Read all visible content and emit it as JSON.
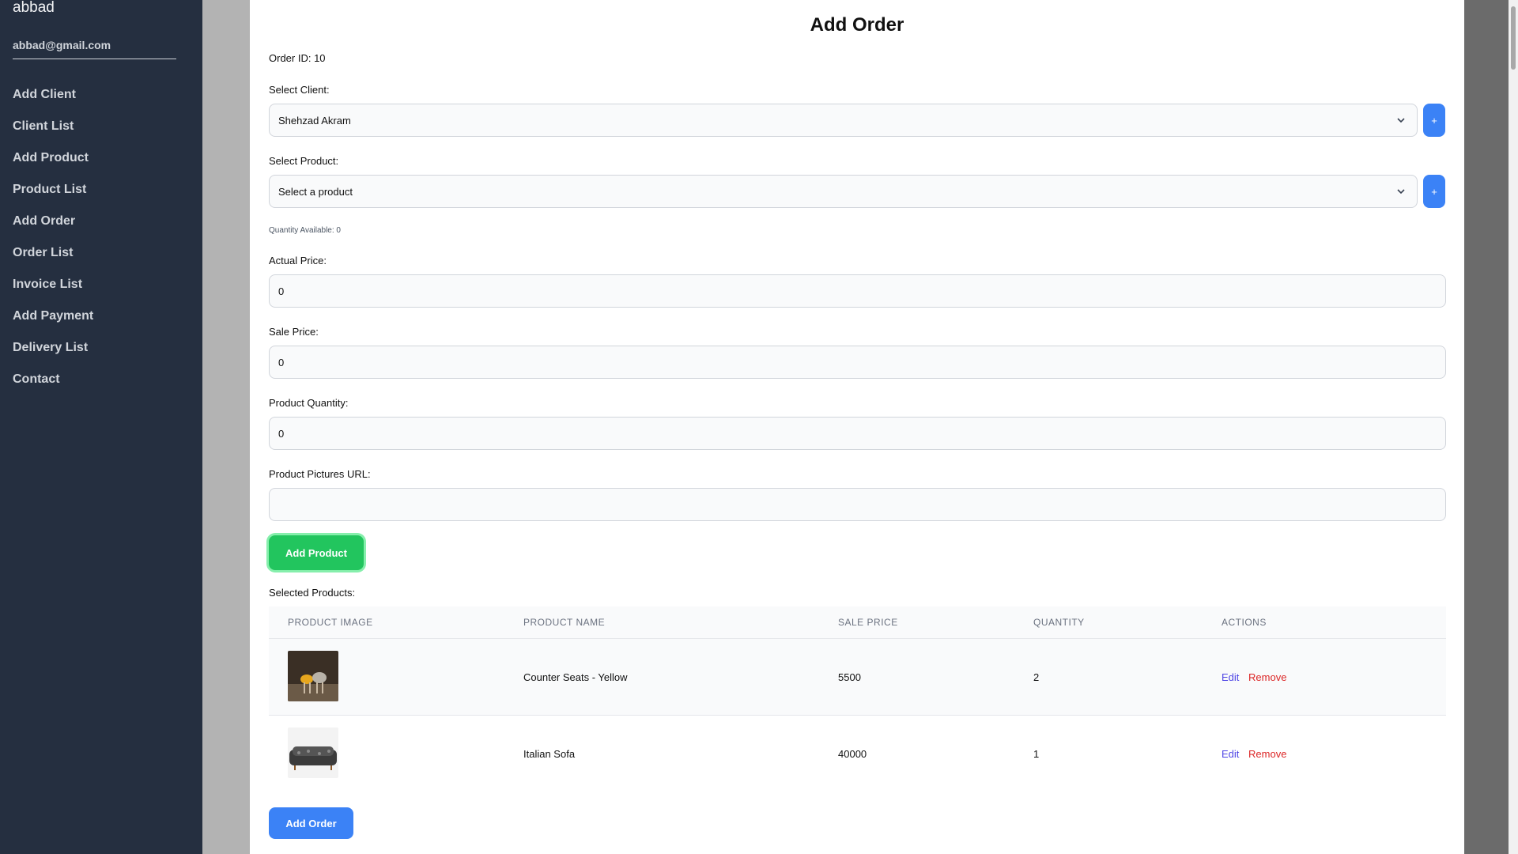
{
  "sidebar": {
    "username": "abbad",
    "email": "abbad@gmail.com",
    "items": [
      {
        "label": "Add Client"
      },
      {
        "label": "Client List"
      },
      {
        "label": "Add Product"
      },
      {
        "label": "Product List"
      },
      {
        "label": "Add Order"
      },
      {
        "label": "Order List"
      },
      {
        "label": "Invoice List"
      },
      {
        "label": "Add Payment"
      },
      {
        "label": "Delivery List"
      },
      {
        "label": "Contact"
      }
    ]
  },
  "form": {
    "title": "Add Order",
    "order_id": "Order ID: 10",
    "client_label": "Select Client:",
    "client_value": "Shehzad Akram",
    "product_label": "Select Product:",
    "product_value": "Select a product",
    "plus": "+",
    "quantity_available": "Quantity Available: 0",
    "actual_price_label": "Actual Price:",
    "actual_price_value": "0",
    "sale_price_label": "Sale Price:",
    "sale_price_value": "0",
    "product_quantity_label": "Product Quantity:",
    "product_quantity_value": "0",
    "pictures_url_label": "Product Pictures URL:",
    "pictures_url_value": "",
    "add_product_button": "Add Product",
    "selected_products_label": "Selected Products:",
    "add_order_button": "Add Order"
  },
  "table": {
    "headers": [
      "PRODUCT IMAGE",
      "PRODUCT NAME",
      "SALE PRICE",
      "QUANTITY",
      "ACTIONS"
    ],
    "rows": [
      {
        "name": "Counter Seats - Yellow",
        "sale_price": "5500",
        "quantity": "2",
        "edit": "Edit",
        "remove": "Remove"
      },
      {
        "name": "Italian Sofa",
        "sale_price": "40000",
        "quantity": "1",
        "edit": "Edit",
        "remove": "Remove"
      }
    ]
  },
  "colors": {
    "sidebar_bg": "#252f40",
    "primary": "#3b82f6",
    "success": "#22c55e",
    "edit": "#4f46e5",
    "remove": "#dc2626"
  }
}
